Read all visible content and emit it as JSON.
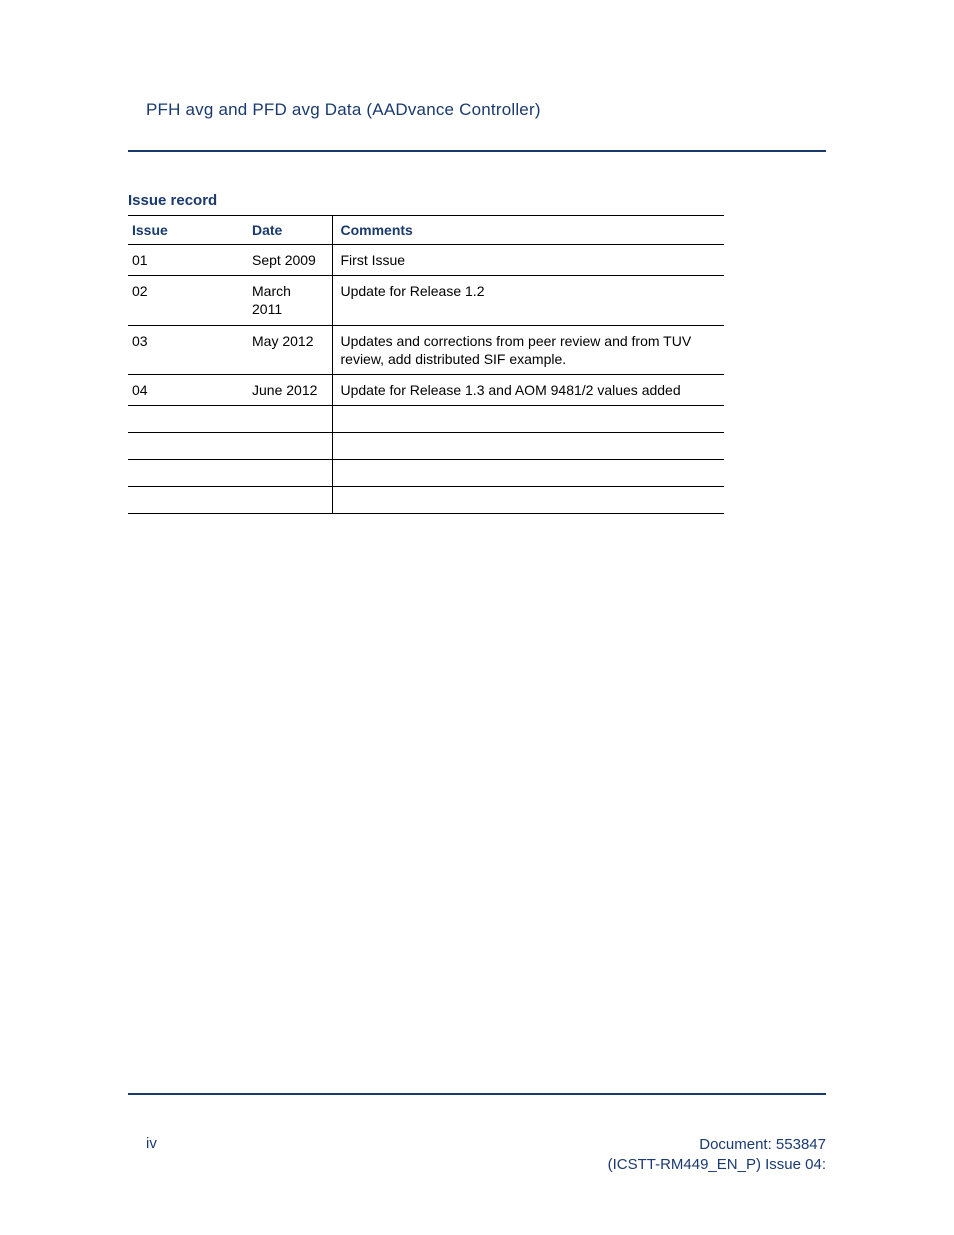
{
  "header": {
    "title": "PFH avg and PFD avg Data   (AADvance Controller)"
  },
  "section": {
    "title": "Issue record"
  },
  "table": {
    "headers": {
      "issue": "Issue",
      "date": "Date",
      "comments": "Comments"
    },
    "rows": [
      {
        "issue": "01",
        "date": "Sept 2009",
        "comments": "First Issue"
      },
      {
        "issue": "02",
        "date": "March 2011",
        "comments": "Update for Release 1.2"
      },
      {
        "issue": "03",
        "date": "May 2012",
        "comments": "Updates and corrections from peer review and from TUV review, add distributed SIF example."
      },
      {
        "issue": "04",
        "date": "June 2012",
        "comments": "Update for Release 1.3 and AOM 9481/2 values added"
      },
      {
        "issue": "",
        "date": "",
        "comments": ""
      },
      {
        "issue": "",
        "date": "",
        "comments": ""
      },
      {
        "issue": "",
        "date": "",
        "comments": ""
      },
      {
        "issue": "",
        "date": "",
        "comments": ""
      }
    ]
  },
  "footer": {
    "page_number": "iv",
    "doc_line1": "Document: 553847",
    "doc_line2": "(ICSTT-RM449_EN_P) Issue 04:"
  }
}
